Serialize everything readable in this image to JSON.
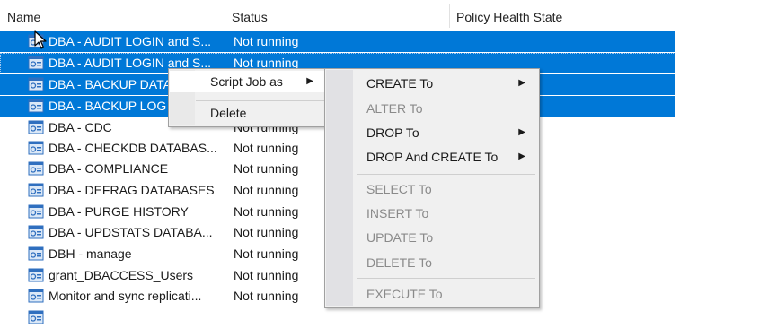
{
  "header": {
    "columns": [
      {
        "label": "Name"
      },
      {
        "label": "Status"
      },
      {
        "label": "Policy Health State"
      }
    ]
  },
  "rows": [
    {
      "name": "DBA - AUDIT LOGIN and S...",
      "status": "Not running"
    },
    {
      "name": "DBA - AUDIT LOGIN and S...",
      "status": "Not running"
    },
    {
      "name": "DBA - BACKUP DATA",
      "status": ""
    },
    {
      "name": "DBA - BACKUP LOG",
      "status": ""
    },
    {
      "name": "DBA - CDC",
      "status": "Not running"
    },
    {
      "name": "DBA - CHECKDB DATABAS...",
      "status": "Not running"
    },
    {
      "name": "DBA - COMPLIANCE",
      "status": "Not running"
    },
    {
      "name": "DBA - DEFRAG DATABASES",
      "status": "Not running"
    },
    {
      "name": "DBA - PURGE HISTORY",
      "status": "Not running"
    },
    {
      "name": "DBA - UPDSTATS DATABA...",
      "status": "Not running"
    },
    {
      "name": "DBH - manage",
      "status": "Not running"
    },
    {
      "name": "grant_DBACCESS_Users",
      "status": "Not running"
    },
    {
      "name": "Monitor and sync replicati...",
      "status": "Not running"
    },
    {
      "name": "",
      "status": ""
    }
  ],
  "context_menu": {
    "items": [
      {
        "label": "Script Job as",
        "has_submenu": true
      },
      {
        "label": "Delete",
        "has_submenu": false
      }
    ]
  },
  "submenu": {
    "items": [
      {
        "label": "CREATE To",
        "enabled": true,
        "has_submenu": true
      },
      {
        "label": "ALTER To",
        "enabled": false,
        "has_submenu": false
      },
      {
        "label": "DROP To",
        "enabled": true,
        "has_submenu": true
      },
      {
        "label": "DROP And CREATE To",
        "enabled": true,
        "has_submenu": true
      },
      {
        "label": "SELECT To",
        "enabled": false,
        "has_submenu": false
      },
      {
        "label": "INSERT To",
        "enabled": false,
        "has_submenu": false
      },
      {
        "label": "UPDATE To",
        "enabled": false,
        "has_submenu": false
      },
      {
        "label": "DELETE To",
        "enabled": false,
        "has_submenu": false
      },
      {
        "label": "EXECUTE To",
        "enabled": false,
        "has_submenu": false
      }
    ]
  },
  "colors": {
    "selection": "#0078d7",
    "menu_bg": "#f0f0f0",
    "disabled_text": "#8a8a8a"
  },
  "icons": {
    "job": "job-icon",
    "submenu_arrow": "triangle-right-icon",
    "cursor": "mouse-cursor-icon"
  }
}
